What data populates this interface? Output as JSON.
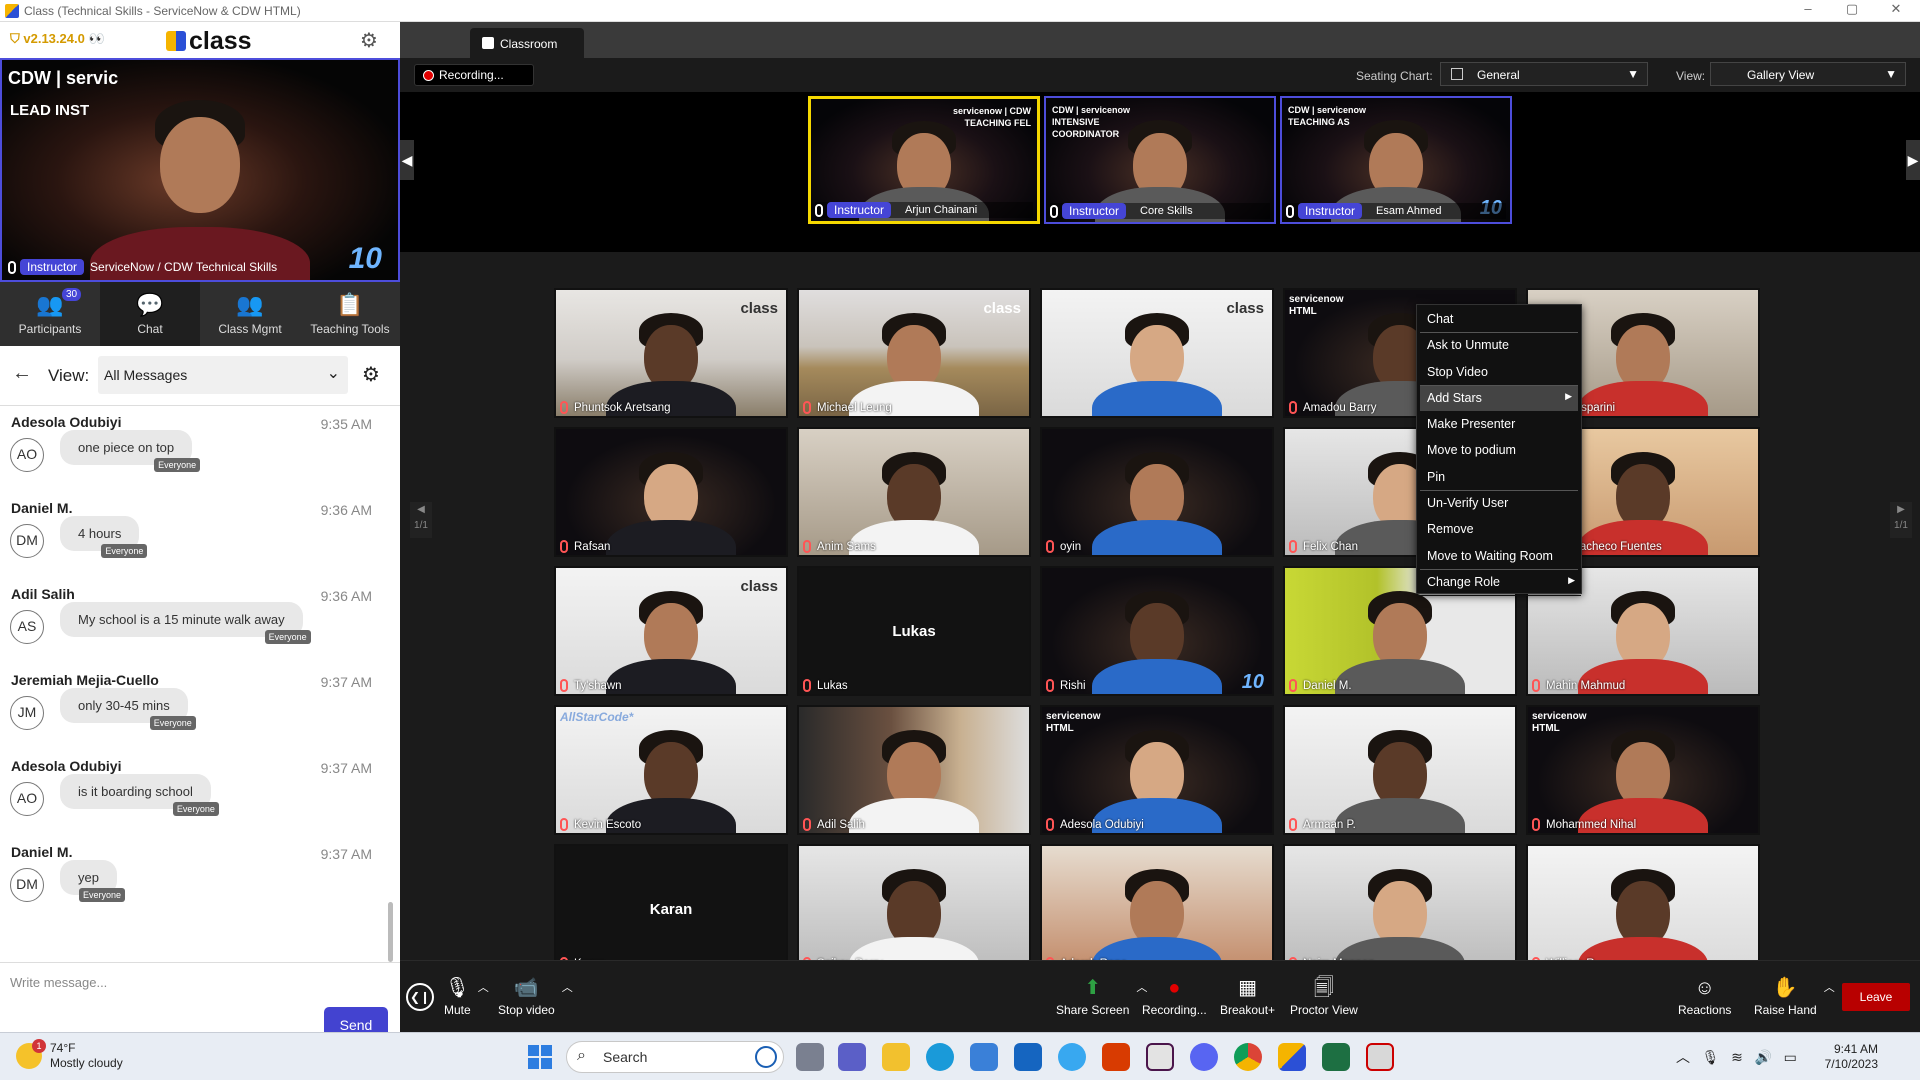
{
  "window": {
    "title": "Class (Technical Skills - ServiceNow & CDW HTML)",
    "controls": [
      "–",
      "▢",
      "✕"
    ]
  },
  "app": {
    "version": "v2.13.24.0",
    "version_emoji": "👀",
    "brand": "class"
  },
  "lead_video": {
    "logo_text": "CDW | servic",
    "title": "LEAD INST",
    "badge": "Instructor",
    "name": "ServiceNow / CDW Technical Skills",
    "mark": "10"
  },
  "left_tabs": [
    {
      "label": "Participants",
      "icon": "participants-icon",
      "count": "30"
    },
    {
      "label": "Chat",
      "icon": "chat-icon"
    },
    {
      "label": "Class Mgmt",
      "icon": "class-mgmt-icon"
    },
    {
      "label": "Teaching Tools",
      "icon": "clipboard-icon"
    }
  ],
  "chat": {
    "view_label": "View:",
    "view_value": "All Messages",
    "messages": [
      {
        "sender": "Adesola Odubiyi",
        "initials": "AO",
        "time": "9:35 AM",
        "text": "one piece on top",
        "audience": "Everyone"
      },
      {
        "sender": "Daniel M.",
        "initials": "DM",
        "time": "9:36 AM",
        "text": "4 hours",
        "audience": "Everyone"
      },
      {
        "sender": "Adil Salih",
        "initials": "AS",
        "time": "9:36 AM",
        "text": "My school is a 15 minute walk away",
        "audience": "Everyone"
      },
      {
        "sender": "Jeremiah Mejia-Cuello",
        "initials": "JM",
        "time": "9:37 AM",
        "text": "only 30-45 mins",
        "audience": "Everyone"
      },
      {
        "sender": "Adesola Odubiyi",
        "initials": "AO",
        "time": "9:37 AM",
        "text": "is it boarding school",
        "audience": "Everyone"
      },
      {
        "sender": "Daniel M.",
        "initials": "DM",
        "time": "9:37 AM",
        "text": "yep",
        "audience": "Everyone"
      }
    ],
    "placeholder": "Write message...",
    "send_label": "Send"
  },
  "main": {
    "tab": "Classroom",
    "recording": "Recording...",
    "seating_label": "Seating Chart:",
    "seating_value": "General",
    "view_label": "View:",
    "view_value": "Gallery View"
  },
  "podium": [
    {
      "name": "Arjun Chainani",
      "badge": "Instructor",
      "sign": "servicenow | CDW\nTEACHING FEL",
      "speaking": true
    },
    {
      "name": "Core Skills",
      "badge": "Instructor",
      "sign": "CDW | servicenow\nINTENSIVE\nCOORDINATOR",
      "speaking": false
    },
    {
      "name": "Esam Ahmed",
      "badge": "Instructor",
      "sign": "CDW | servicenow\nTEACHING AS",
      "speaking": false
    }
  ],
  "pager": {
    "left": "1/1",
    "right": "1/1"
  },
  "students": [
    {
      "name": "Phuntsok Aretsang",
      "bg": "bg-room",
      "overlay": "class"
    },
    {
      "name": "Michael Leung",
      "bg": "bg-wood",
      "overlay": "class"
    },
    {
      "name": "",
      "bg": "bg-white",
      "overlay": "class"
    },
    {
      "name": "Amadou Barry",
      "bg": "bg-dark",
      "overlay": "servicenow\nHTML",
      "ten": true
    },
    {
      "name": "Kai Gasparini",
      "bg": "bg-warm"
    },
    {
      "name": "Rafsan",
      "bg": "bg-dark"
    },
    {
      "name": "Anim Sams",
      "bg": "bg-warm"
    },
    {
      "name": "oyin",
      "bg": "bg-dark"
    },
    {
      "name": "Felix Chan",
      "bg": "bg-gray"
    },
    {
      "name": "Saul Pacheco Fuentes",
      "bg": "bg-peach"
    },
    {
      "name": "Ty'shawn",
      "bg": "bg-white",
      "overlay": "class"
    },
    {
      "name": "Lukas",
      "bg": "black",
      "big": "Lukas"
    },
    {
      "name": "Rishi",
      "bg": "bg-dark",
      "ten": true
    },
    {
      "name": "Daniel M.",
      "bg": "bg-lime"
    },
    {
      "name": "Mahin Mahmud",
      "bg": "bg-gray"
    },
    {
      "name": "Kevin Escoto",
      "bg": "bg-white",
      "overlay": "AllStarCode*"
    },
    {
      "name": "Adil Salih",
      "bg": "bg-shelf"
    },
    {
      "name": "Adesola Odubiyi",
      "bg": "bg-dark",
      "overlay": "servicenow\nHTML"
    },
    {
      "name": "Armaan P.",
      "bg": "bg-white"
    },
    {
      "name": "Mohammed Nihal",
      "bg": "bg-dark",
      "overlay": "servicenow\nHTML"
    },
    {
      "name": "Karan",
      "bg": "black",
      "big": "Karan"
    },
    {
      "name": "Saikou Barry",
      "bg": "bg-gray"
    },
    {
      "name": "Adarsh Rana",
      "bg": "bg-red"
    },
    {
      "name": "Naim Mannan",
      "bg": "bg-gray"
    },
    {
      "name": "William R",
      "bg": "bg-white"
    }
  ],
  "context_menu": [
    {
      "label": "Chat"
    },
    {
      "label": "Ask to Unmute"
    },
    {
      "label": "Stop Video"
    },
    {
      "label": "Add Stars",
      "sub": true
    },
    {
      "label": "Make Presenter"
    },
    {
      "label": "Move to podium"
    },
    {
      "label": "Pin"
    },
    {
      "label": "Un-Verify User"
    },
    {
      "label": "Remove"
    },
    {
      "label": "Move to Waiting Room"
    },
    {
      "label": "Change Role",
      "sub": true
    }
  ],
  "bottom_bar": {
    "mute": "Mute",
    "stop_video": "Stop video",
    "share": "Share Screen",
    "recording": "Recording...",
    "breakout": "Breakout+",
    "proctor": "Proctor View",
    "reactions": "Reactions",
    "raise_hand": "Raise Hand",
    "leave": "Leave"
  },
  "taskbar": {
    "temp": "74°F",
    "weather": "Mostly cloudy",
    "weather_badge": "1",
    "search": "Search",
    "time": "9:41 AM",
    "date": "7/10/2023"
  },
  "colors": {
    "accent": "#4545d6",
    "leave": "#b80000",
    "speaking": "#f5d800",
    "recording": "#e20000"
  }
}
